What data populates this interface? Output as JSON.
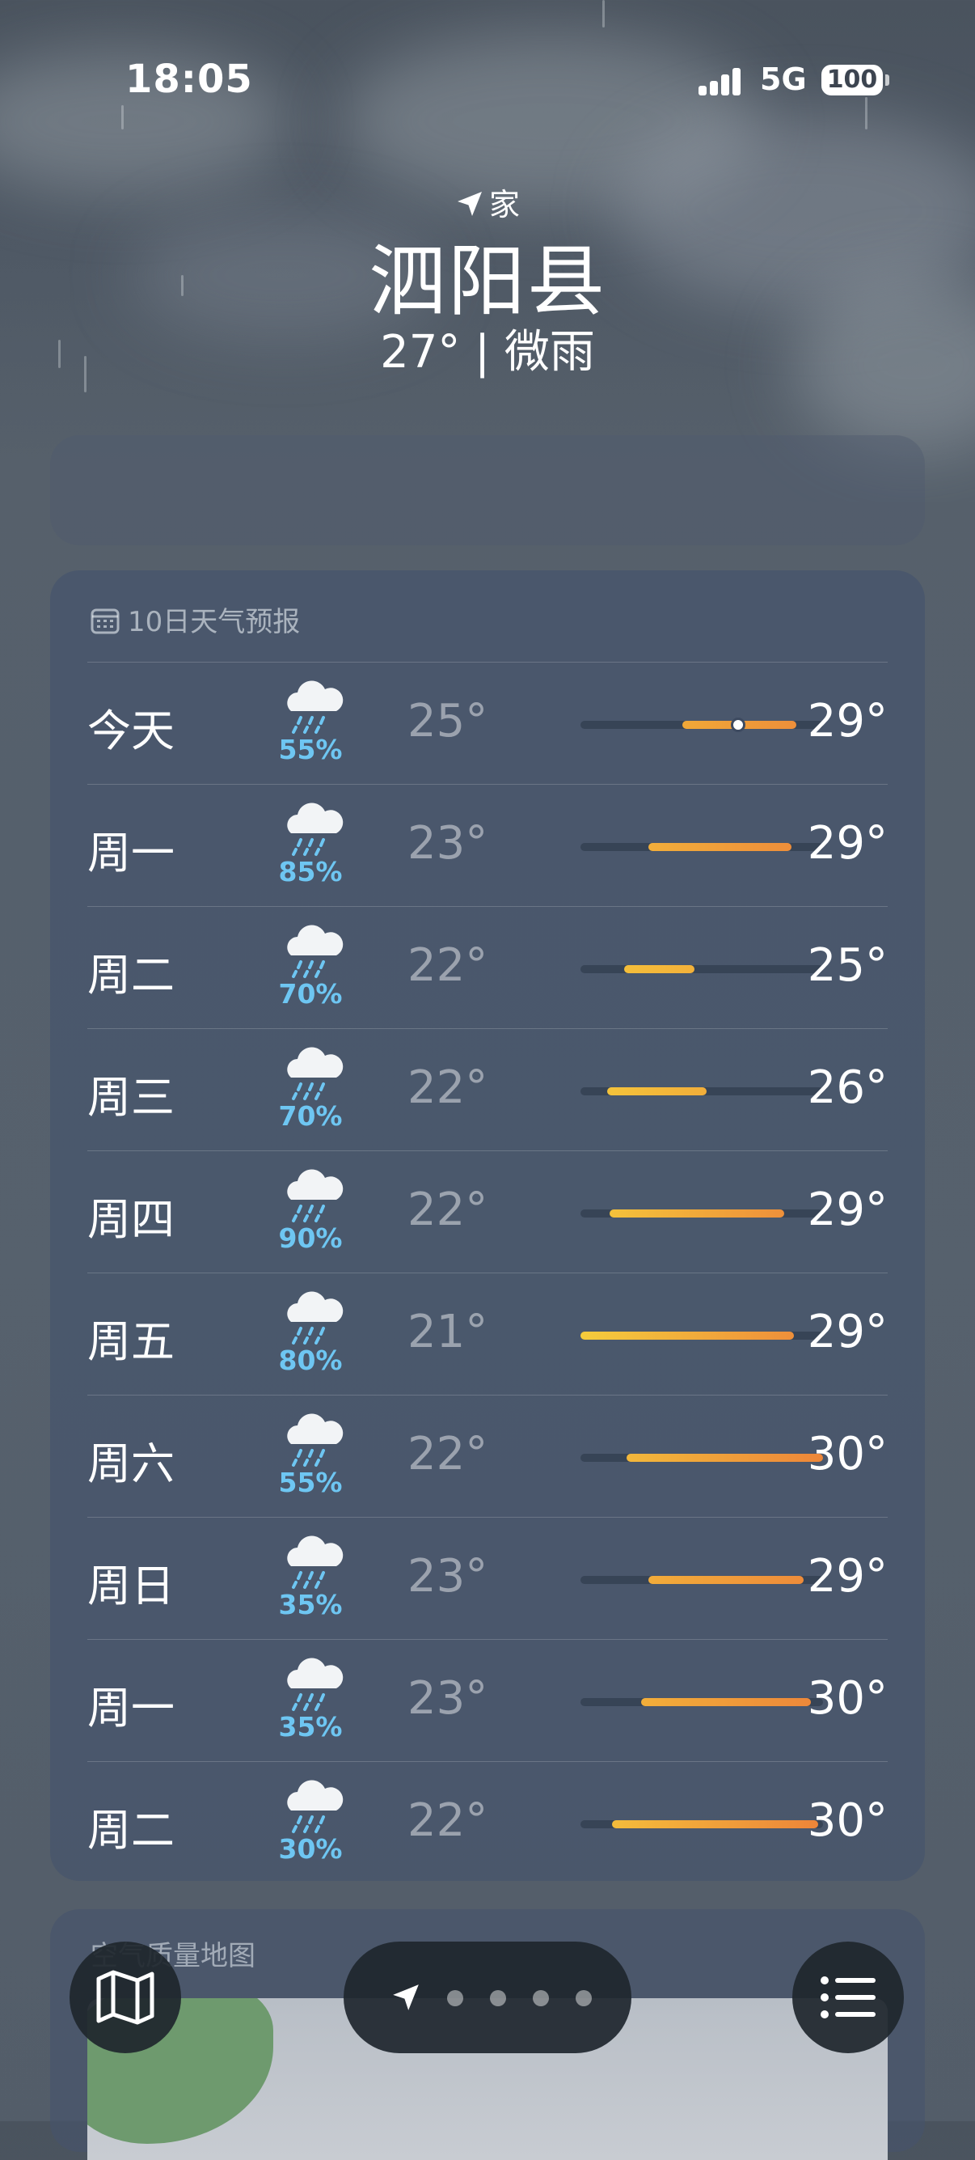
{
  "status_bar": {
    "time": "18:05",
    "network": "5G",
    "battery": "100"
  },
  "header": {
    "location_label": "家",
    "city": "泗阳县",
    "current": "27° | 微雨"
  },
  "forecast": {
    "title": "10日天气预报",
    "days": [
      {
        "day": "今天",
        "precip": "55%",
        "low": "25°",
        "high": "29°",
        "bar_from": 0.42,
        "bar_to": 0.89,
        "bar_start_color": "#f0a838",
        "bar_end_color": "#ee8f3a",
        "current_marker": 0.65
      },
      {
        "day": "周一",
        "precip": "85%",
        "low": "23°",
        "high": "29°",
        "bar_from": 0.28,
        "bar_to": 0.87,
        "bar_start_color": "#f2ae3a",
        "bar_end_color": "#ee8e3a"
      },
      {
        "day": "周二",
        "precip": "70%",
        "low": "22°",
        "high": "25°",
        "bar_from": 0.18,
        "bar_to": 0.47,
        "bar_start_color": "#f4be3a",
        "bar_end_color": "#f3b13a"
      },
      {
        "day": "周三",
        "precip": "70%",
        "low": "22°",
        "high": "26°",
        "bar_from": 0.11,
        "bar_to": 0.52,
        "bar_start_color": "#f4c33b",
        "bar_end_color": "#f2ae3a"
      },
      {
        "day": "周四",
        "precip": "90%",
        "low": "22°",
        "high": "29°",
        "bar_from": 0.12,
        "bar_to": 0.84,
        "bar_start_color": "#f4c23b",
        "bar_end_color": "#ee903a"
      },
      {
        "day": "周五",
        "precip": "80%",
        "low": "21°",
        "high": "29°",
        "bar_from": 0.0,
        "bar_to": 0.88,
        "bar_start_color": "#f5cc3c",
        "bar_end_color": "#ee8f3a"
      },
      {
        "day": "周六",
        "precip": "55%",
        "low": "22°",
        "high": "30°",
        "bar_from": 0.19,
        "bar_to": 1.0,
        "bar_start_color": "#f3b83b",
        "bar_end_color": "#ed8639"
      },
      {
        "day": "周日",
        "precip": "35%",
        "low": "23°",
        "high": "29°",
        "bar_from": 0.28,
        "bar_to": 0.92,
        "bar_start_color": "#f2ac3a",
        "bar_end_color": "#ee8c3a"
      },
      {
        "day": "周一",
        "precip": "35%",
        "low": "23°",
        "high": "30°",
        "bar_from": 0.25,
        "bar_to": 0.95,
        "bar_start_color": "#f2ae3a",
        "bar_end_color": "#ed883a"
      },
      {
        "day": "周二",
        "precip": "30%",
        "low": "22°",
        "high": "30°",
        "bar_from": 0.13,
        "bar_to": 0.98,
        "bar_start_color": "#f4bc3b",
        "bar_end_color": "#ed8539"
      }
    ]
  },
  "air_quality": {
    "title": "空气质量地图"
  },
  "toolbar": {
    "page_count": 4
  },
  "colors": {
    "precip_text": "#6ec6f2",
    "toolbar_bg": "#1e262e"
  },
  "icons": {
    "map": "map-icon",
    "list": "list-icon",
    "location": "location-arrow-icon",
    "calendar": "calendar-icon",
    "weather": "rain-cloud-icon"
  }
}
